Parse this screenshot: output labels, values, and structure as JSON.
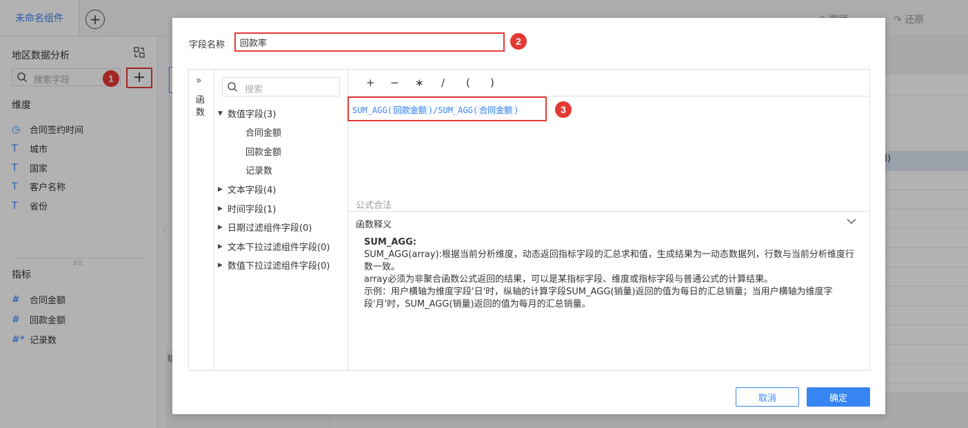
{
  "topbar": {
    "tab_label": "未命名组件",
    "add_label": "+",
    "undo_label": "撤销",
    "redo_label": "还原"
  },
  "sidebar": {
    "title": "地区数据分析",
    "search_placeholder": "搜索字段",
    "add_label": "+",
    "dimension_header": "维度",
    "dimensions": [
      {
        "icon": "clock-icon",
        "glyph": "◷",
        "label": "合同签约时间"
      },
      {
        "icon": "text-field-icon",
        "glyph": "T",
        "label": "城市"
      },
      {
        "icon": "text-field-icon",
        "glyph": "T",
        "label": "国家"
      },
      {
        "icon": "text-field-icon",
        "glyph": "T",
        "label": "客户名称"
      },
      {
        "icon": "text-field-icon",
        "glyph": "T",
        "label": "省份"
      }
    ],
    "measure_header": "指标",
    "measures": [
      {
        "icon": "number-field-icon",
        "glyph": "#",
        "label": "合同金额"
      },
      {
        "icon": "number-field-icon",
        "glyph": "#",
        "label": "回款金额"
      },
      {
        "icon": "record-count-icon",
        "glyph": "#*",
        "label": "记录数"
      }
    ]
  },
  "background": {
    "right_cell_text": "和)",
    "mid_lower_text": "结"
  },
  "annotations": [
    "1",
    "2",
    "3"
  ],
  "dialog": {
    "field_name_label": "字段名称",
    "field_name_value": "回款率",
    "function_tab_label": "函数",
    "tree_search_placeholder": "搜索",
    "tree": {
      "groups": [
        {
          "label": "数值字段(3)",
          "expanded": true,
          "children": [
            "合同金额",
            "回款金额",
            "记录数"
          ]
        },
        {
          "label": "文本字段(4)",
          "expanded": false
        },
        {
          "label": "时间字段(1)",
          "expanded": false
        },
        {
          "label": "日期过滤组件字段(0)",
          "expanded": false
        },
        {
          "label": "文本下拉过滤组件字段(0)",
          "expanded": false
        },
        {
          "label": "数值下拉过滤组件字段(0)",
          "expanded": false
        }
      ]
    },
    "operators": [
      "+",
      "−",
      "∗",
      "/",
      "(",
      ")"
    ],
    "formula": {
      "fn1": "SUM_AGG(",
      "arg1": "回款金额",
      "mid": ")/SUM_AGG(",
      "arg2": "合同金额",
      "end": ")"
    },
    "formula_status": "公式合法",
    "explain_title": "函数释义",
    "explain": {
      "name": "SUM_AGG:",
      "line1": "SUM_AGG(array):根据当前分析维度，动态返回指标字段的汇总求和值，生成结果为一动态数据列，行数与当前分析维度行数一致。",
      "line2": " array必须为非聚合函数公式返回的结果，可以是某指标字段、维度或指标字段与普通公式的计算结果。",
      "line3": " 示例：用户横轴为维度字段'日'时，纵轴的计算字段SUM_AGG(销量)返回的值为每日的汇总销量；当用户横轴为维度字段'月'时，SUM_AGG(销量)返回的值为每月的汇总销量。"
    },
    "cancel_label": "取消",
    "ok_label": "确定"
  },
  "colors": {
    "accent": "#3685f2",
    "highlight_red": "#e53935"
  }
}
